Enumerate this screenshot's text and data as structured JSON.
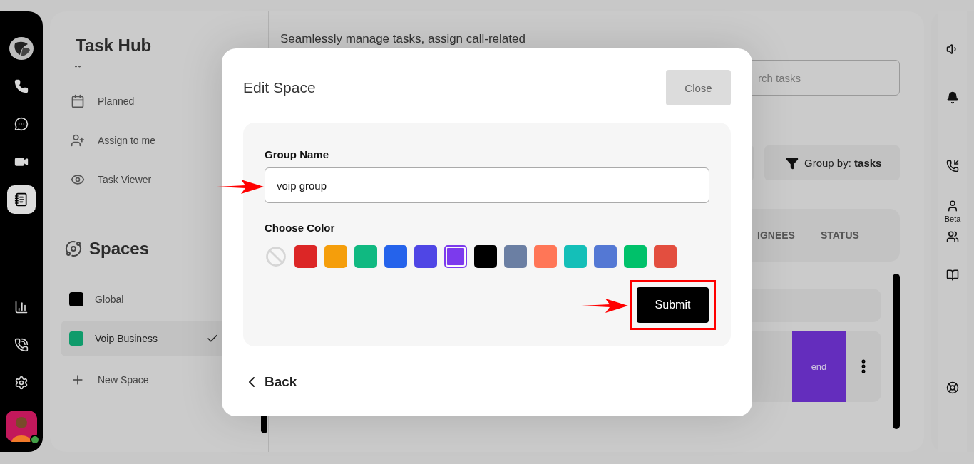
{
  "rail": {
    "items": [
      {
        "kind": "logo",
        "selected": false
      },
      {
        "kind": "phone",
        "selected": false
      },
      {
        "kind": "chat",
        "selected": false
      },
      {
        "kind": "video",
        "selected": false
      },
      {
        "kind": "notes",
        "selected": true
      }
    ],
    "bottom_items": [
      {
        "kind": "analytics",
        "selected": false
      },
      {
        "kind": "call-spark",
        "selected": false
      },
      {
        "kind": "settings",
        "selected": false
      }
    ],
    "user": {
      "online": true
    }
  },
  "sidebar": {
    "title": "Task Hub",
    "nav": [
      {
        "kind": "important"
      },
      {
        "kind": "planned",
        "label": "Planned"
      },
      {
        "kind": "assign",
        "label": "Assign to me"
      },
      {
        "kind": "viewer",
        "label": "Task Viewer"
      }
    ],
    "spaces": {
      "title": "Spaces",
      "items": [
        {
          "name": "Global",
          "color": "#000000",
          "selected": false
        },
        {
          "name": "Voip Business",
          "color": "#0f9b6b",
          "selected": true
        }
      ],
      "new_label": "New Space"
    }
  },
  "content": {
    "intro": "Seamlessly manage tasks, assign call-related",
    "search": {
      "placeholder": "rch tasks"
    },
    "group_by": "Group by: **tasks**",
    "columns": [
      "IGNEES",
      "STATUS"
    ],
    "rows": [
      {
        "kind": "blank"
      },
      {
        "kind": "task",
        "status": "end",
        "color": "#642dbd"
      }
    ]
  },
  "right_rail": {
    "items": [
      {
        "kind": "speaker"
      },
      {
        "kind": "bell"
      },
      {
        "kind": "call-star"
      },
      {
        "kind": "user",
        "label": "Beta"
      },
      {
        "kind": "users"
      },
      {
        "kind": "book"
      },
      {
        "kind": "lifebuoy"
      }
    ]
  },
  "modal": {
    "title": "Edit Space",
    "close": "Close",
    "field_label": "Group Name",
    "field_value": "voip group",
    "field_pointed": true,
    "color_label": "Choose Color",
    "swatches": [
      {
        "kind": "none",
        "selected": false
      },
      {
        "kind": "color",
        "color": "#dc2626",
        "selected": false
      },
      {
        "kind": "color",
        "color": "#f59e0b",
        "selected": false
      },
      {
        "kind": "color",
        "color": "#10b981",
        "selected": false
      },
      {
        "kind": "color",
        "color": "#2563eb",
        "selected": false
      },
      {
        "kind": "color",
        "color": "#4f46e5",
        "selected": false
      },
      {
        "kind": "color",
        "color": "#7c3aed",
        "selected": true
      },
      {
        "kind": "color",
        "color": "#000000",
        "selected": false
      },
      {
        "kind": "color",
        "color": "#6b7fa3",
        "selected": false
      },
      {
        "kind": "color",
        "color": "#ff7657",
        "selected": false
      },
      {
        "kind": "color",
        "color": "#14bfb8",
        "selected": false
      },
      {
        "kind": "color",
        "color": "#5478d4",
        "selected": false
      },
      {
        "kind": "color",
        "color": "#00c16a",
        "selected": false
      },
      {
        "kind": "color",
        "color": "#e34e3f",
        "selected": false
      }
    ],
    "submit": "Submit",
    "submit_pointed": true,
    "submit_outlined": true,
    "back": "Back"
  }
}
